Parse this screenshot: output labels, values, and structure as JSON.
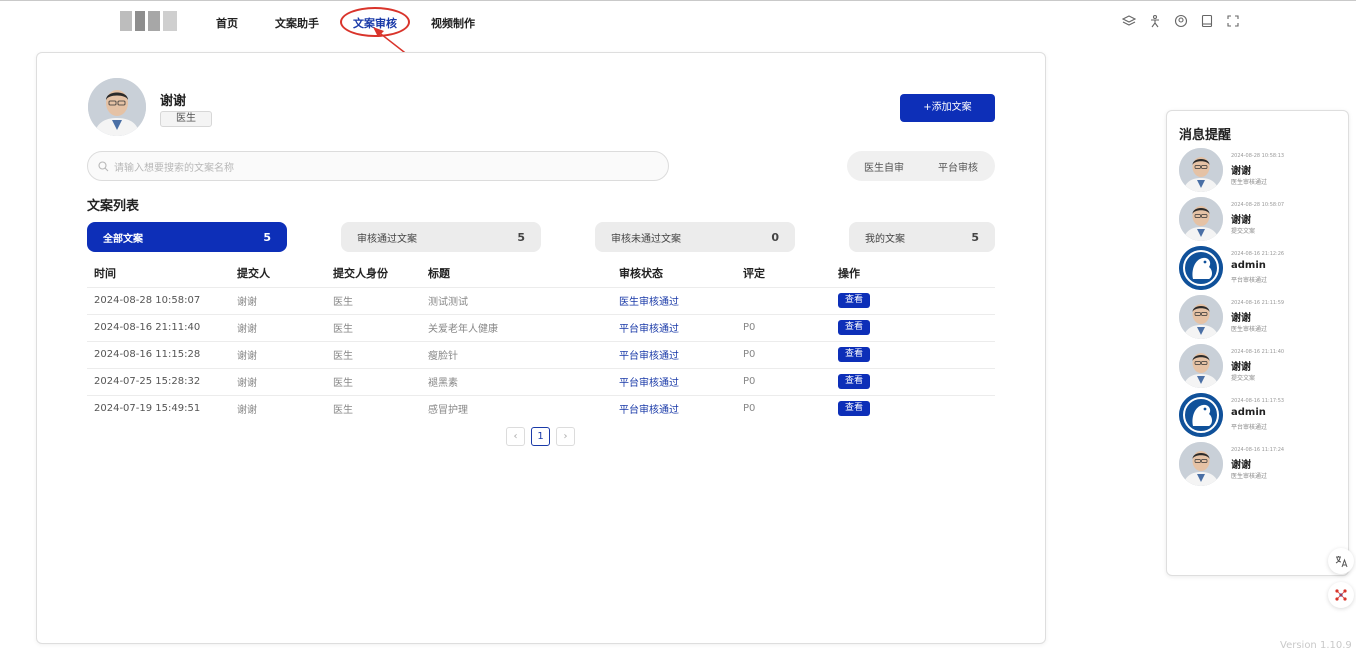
{
  "nav": {
    "items": [
      {
        "label": "首页"
      },
      {
        "label": "文案助手"
      },
      {
        "label": "文案审核"
      },
      {
        "label": "视频制作"
      }
    ],
    "active": "文案审核"
  },
  "header_icons": [
    "layers-icon",
    "accessibility-icon",
    "user-circle-icon",
    "tablet-icon",
    "fullscreen-icon"
  ],
  "profile": {
    "name": "谢谢",
    "role": "医生"
  },
  "add_button": "+添加文案",
  "search": {
    "placeholder": "请输入想要搜索的文案名称"
  },
  "filter": {
    "options": [
      "医生自审",
      "平台审核"
    ]
  },
  "list_title": "文案列表",
  "tabs": [
    {
      "label": "全部文案",
      "count": "5"
    },
    {
      "label": "审核通过文案",
      "count": "5"
    },
    {
      "label": "审核未通过文案",
      "count": "0"
    },
    {
      "label": "我的文案",
      "count": "5"
    }
  ],
  "table": {
    "headers": [
      "时间",
      "提交人",
      "提交人身份",
      "标题",
      "审核状态",
      "评定",
      "操作"
    ],
    "rows": [
      {
        "time": "2024-08-28 10:58:07",
        "submitter": "谢谢",
        "identity": "医生",
        "title": "测试测试",
        "status": "医生审核通过",
        "rating": "",
        "action": "查看"
      },
      {
        "time": "2024-08-16 21:11:40",
        "submitter": "谢谢",
        "identity": "医生",
        "title": "关爱老年人健康",
        "status": "平台审核通过",
        "rating": "P0",
        "action": "查看"
      },
      {
        "time": "2024-08-16 11:15:28",
        "submitter": "谢谢",
        "identity": "医生",
        "title": "瘦脸针",
        "status": "平台审核通过",
        "rating": "P0",
        "action": "查看"
      },
      {
        "time": "2024-07-25 15:28:32",
        "submitter": "谢谢",
        "identity": "医生",
        "title": "褪黑素",
        "status": "平台审核通过",
        "rating": "P0",
        "action": "查看"
      },
      {
        "time": "2024-07-19 15:49:51",
        "submitter": "谢谢",
        "identity": "医生",
        "title": "感冒护理",
        "status": "平台审核通过",
        "rating": "P0",
        "action": "查看"
      }
    ]
  },
  "pagination": {
    "current": "1"
  },
  "messages": {
    "title": "消息提醒",
    "items": [
      {
        "time": "2024-08-28 10:58:13",
        "name": "谢谢",
        "desc": "医生审核通过",
        "avatar": "doctor"
      },
      {
        "time": "2024-08-28 10:58:07",
        "name": "谢谢",
        "desc": "提交文案",
        "avatar": "doctor"
      },
      {
        "time": "2024-08-16 21:12:26",
        "name": "admin",
        "desc": "平台审核通过",
        "avatar": "admin"
      },
      {
        "time": "2024-08-16 21:11:59",
        "name": "谢谢",
        "desc": "医生审核通过",
        "avatar": "doctor"
      },
      {
        "time": "2024-08-16 21:11:40",
        "name": "谢谢",
        "desc": "提交文案",
        "avatar": "doctor"
      },
      {
        "time": "2024-08-16 11:17:53",
        "name": "admin",
        "desc": "平台审核通过",
        "avatar": "admin"
      },
      {
        "time": "2024-08-16 11:17:24",
        "name": "谢谢",
        "desc": "医生审核通过",
        "avatar": "doctor"
      }
    ]
  },
  "version": "Version 1.10.9",
  "colors": {
    "primary": "#0d2fb8",
    "link": "#1a3aa8",
    "annotation": "#d9342b"
  }
}
